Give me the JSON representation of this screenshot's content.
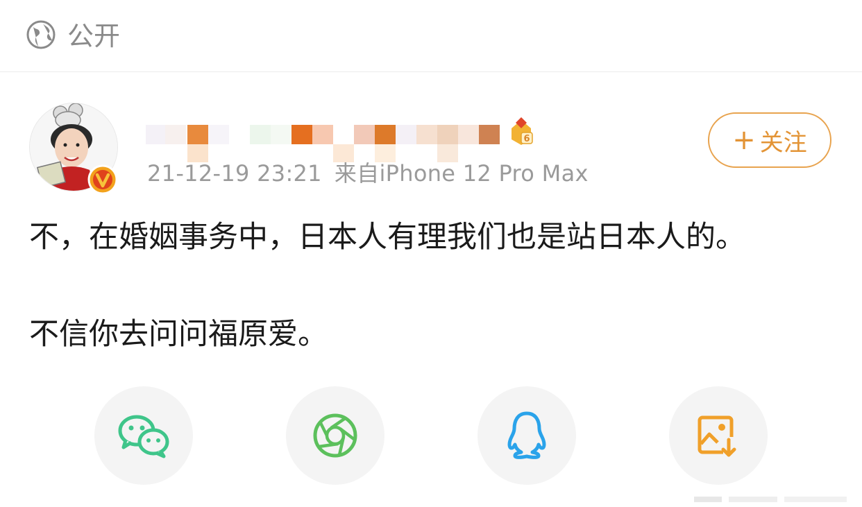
{
  "visibility": {
    "icon": "globe-icon",
    "label": "公开"
  },
  "post": {
    "author": {
      "avatar": "avatar",
      "verified_badge": "verified-v-icon",
      "level_icon": "level-6-icon"
    },
    "timestamp": "21-12-19 23:21",
    "source": "来自iPhone 12 Pro Max",
    "follow_label": "关注",
    "text_lines": [
      "不，在婚姻事务中，日本人有理我们也是站日本人的。",
      "不信你去问问福原爱。"
    ]
  },
  "share": {
    "wechat_icon": "wechat-icon",
    "moments_icon": "moments-icon",
    "qq_icon": "qq-icon",
    "save_icon": "save-image-icon"
  },
  "colors": {
    "accent_orange": "#e39436",
    "wechat_green": "#3fc58a",
    "moments_green": "#5cc05c",
    "qq_blue": "#2aa3ea",
    "save_orange": "#f0a02a",
    "meta_gray": "#9a9a9a"
  }
}
